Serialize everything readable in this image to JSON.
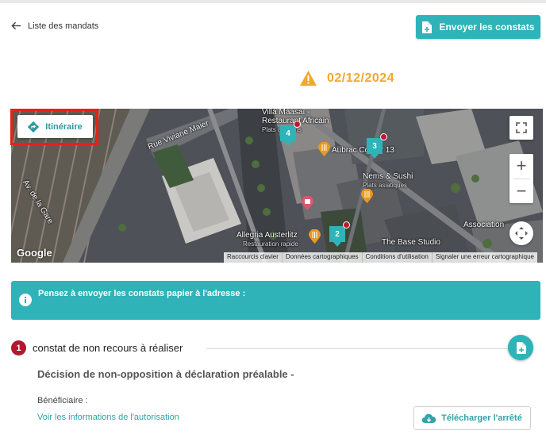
{
  "nav": {
    "back_label": "Liste des mandats"
  },
  "actions": {
    "send_label": "Envoyer les constats"
  },
  "alert": {
    "date": "02/12/2024",
    "color": "#f0a92a"
  },
  "map": {
    "itinerary_label": "Itinéraire",
    "labels": {
      "street1": "Rue Viviane Maier",
      "street2": "Av. de la Gare",
      "poi1": "Villa Maasaï -",
      "poi1b": "Restaurant Africain",
      "poi1c": "Plats africains",
      "poi2": "Aubrac Corner 13",
      "poi3": "Nems & Sushi",
      "poi3b": "Plats asiatiques",
      "poi4": "Allegria Austerlitz",
      "poi4b": "Restauration rapide",
      "poi5": "The Base Studio",
      "poi6": "Association"
    },
    "markers": [
      "4",
      "3",
      "2"
    ],
    "google_logo": "Google",
    "attribution": [
      "Raccourcis clavier",
      "Données cartographiques",
      "Conditions d'utilisation",
      "Signaler une erreur cartographique"
    ]
  },
  "info": {
    "text": "Pensez à envoyer les constats papier à l'adresse :"
  },
  "step": {
    "number": "1",
    "title": "constat de non recours à réaliser",
    "decision": "Décision de non-opposition à déclaration préalable -",
    "beneficiary_label": "Bénéficiaire :",
    "view_link": "Voir les informations de l'autorisation",
    "download_label": "Télécharger l'arrêté"
  },
  "colors": {
    "teal": "#2fb3b8",
    "badge_red": "#b0182f",
    "highlight_red": "#e2231a"
  }
}
